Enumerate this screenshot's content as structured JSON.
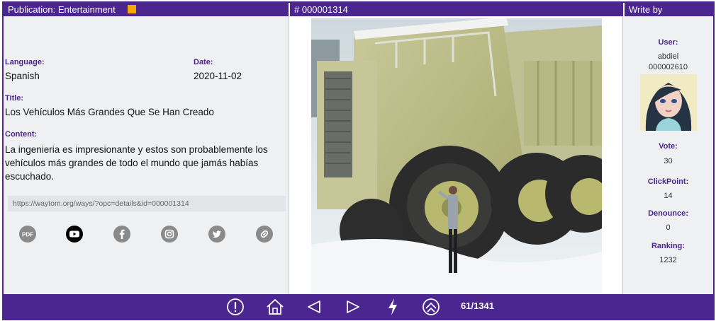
{
  "header": {
    "publication": "Publication: Entertainment",
    "number": "# 000001314",
    "write_by": "Write by"
  },
  "details": {
    "language_label": "Language:",
    "language": "Spanish",
    "date_label": "Date:",
    "date": "2020-11-02",
    "title_label": "Title:",
    "title": "Los Vehículos Más Grandes Que Se Han Creado",
    "content_label": "Content:",
    "content": "La ingenieria es impresionante y estos son probablemente los vehículos más grandes de todo el mundo que jamás habías escuchado.",
    "url": "https://waytom.org/ways/?opc=details&id=000001314"
  },
  "share": [
    "pdf-icon",
    "youtube-icon",
    "facebook-icon",
    "instagram-icon",
    "twitter-icon",
    "link-icon"
  ],
  "author": {
    "user_label": "User:",
    "user_name": "abdiel",
    "user_id": "000002610",
    "vote_label": "Vote:",
    "vote": "30",
    "clickpoint_label": "ClickPoint:",
    "clickpoint": "14",
    "denounce_label": "Denounce:",
    "denounce": "0",
    "ranking_label": "Ranking:",
    "ranking": "1232"
  },
  "footer": {
    "icons": [
      "alert-icon",
      "home-icon",
      "prev-icon",
      "next-icon",
      "flash-icon",
      "top-icon"
    ],
    "pager": "61/1341"
  },
  "colors": {
    "brand": "#4b2590",
    "accent": "#f7a800",
    "background": "#eef0f2"
  }
}
